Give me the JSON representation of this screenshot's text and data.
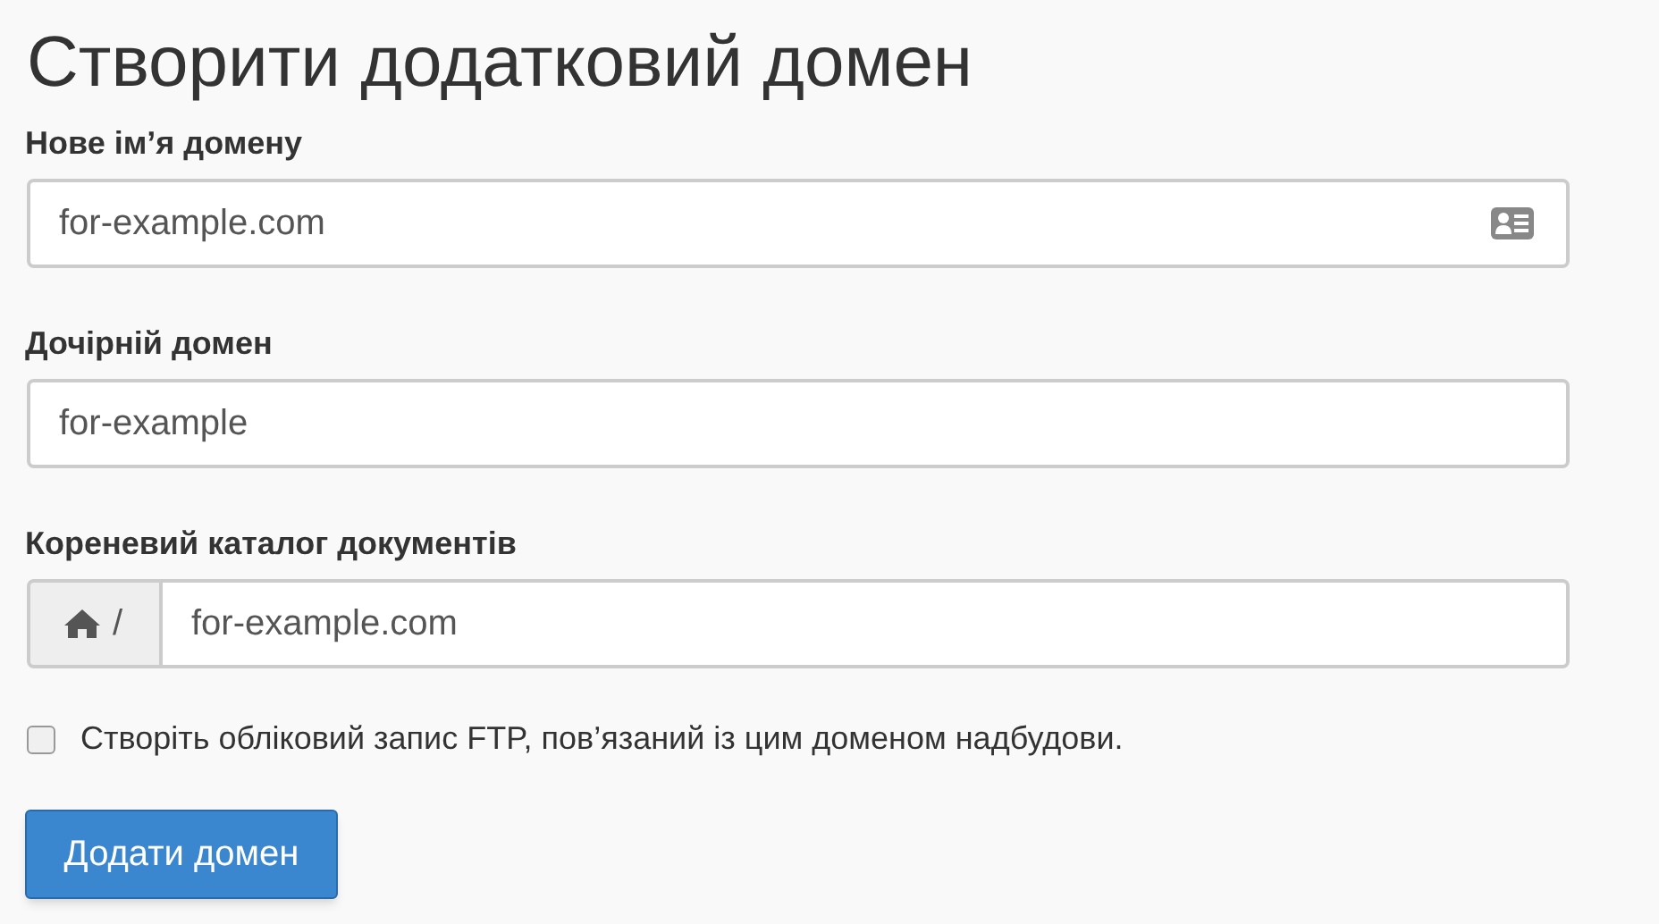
{
  "title": "Створити додатковий домен",
  "fields": [
    {
      "label": "Нове ім’я домену",
      "value": "for-example.com",
      "kind": "card"
    },
    {
      "label": "Дочірній домен",
      "value": "for-example",
      "kind": "plain"
    },
    {
      "label": "Кореневий каталог документів",
      "value": "for-example.com",
      "kind": "home",
      "prefix": "/"
    }
  ],
  "ftp_checkbox": {
    "label": "Створіть обліковий запис FTP, пов’язаний із цим доменом надбудови.",
    "checked": false
  },
  "submit_button": "Додати домен"
}
